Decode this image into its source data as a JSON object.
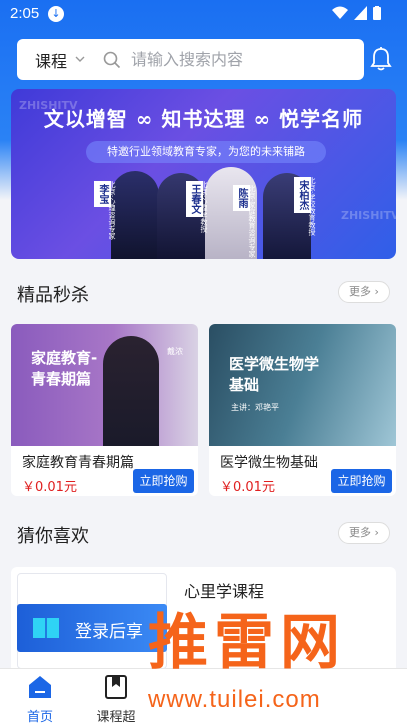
{
  "status": {
    "time": "2:05"
  },
  "search": {
    "category": "课程",
    "placeholder": "请输入搜索内容"
  },
  "banner": {
    "watermark": "ZHISHITV",
    "title": "文以增智 ∞ 知书达理 ∞ 悦学名师",
    "subtitle": "特邀行业领域教育专家，为您的未来铺路",
    "teachers": [
      "李宝",
      "王春文",
      "陈雨",
      "宋柏杰"
    ],
    "teacher_desc": [
      "北京·心理咨询专家",
      "北京·心理学教授",
      "北京·家庭教育咨询专家",
      "北京·学校教育教授"
    ]
  },
  "flash_sale": {
    "title": "精品秒杀",
    "more": "更多 ›",
    "courses": [
      {
        "cover_title": "家庭教育-\n青春期篇",
        "cover_name": "戴浓",
        "name": "家庭教育青春期篇",
        "price": "￥0.01元",
        "buy": "立即抢购"
      },
      {
        "cover_title": "医学微生物学\n基础",
        "cover_author": "主讲：邓艳平",
        "name": "医学微生物基础",
        "price": "￥0.01元",
        "buy": "立即抢购"
      }
    ]
  },
  "guess": {
    "title": "猜你喜欢",
    "more": "更多 ›",
    "item_name": "心里学课程",
    "login_text": "登录后享"
  },
  "tabbar": {
    "tabs": [
      {
        "label": "首页"
      },
      {
        "label": "课程超"
      }
    ]
  },
  "watermark": {
    "logo_text": "推雷网",
    "url": "www.tuilei.com"
  },
  "colors": {
    "primary": "#1b66e6",
    "price": "#e02020",
    "watermark": "#f5641a"
  }
}
